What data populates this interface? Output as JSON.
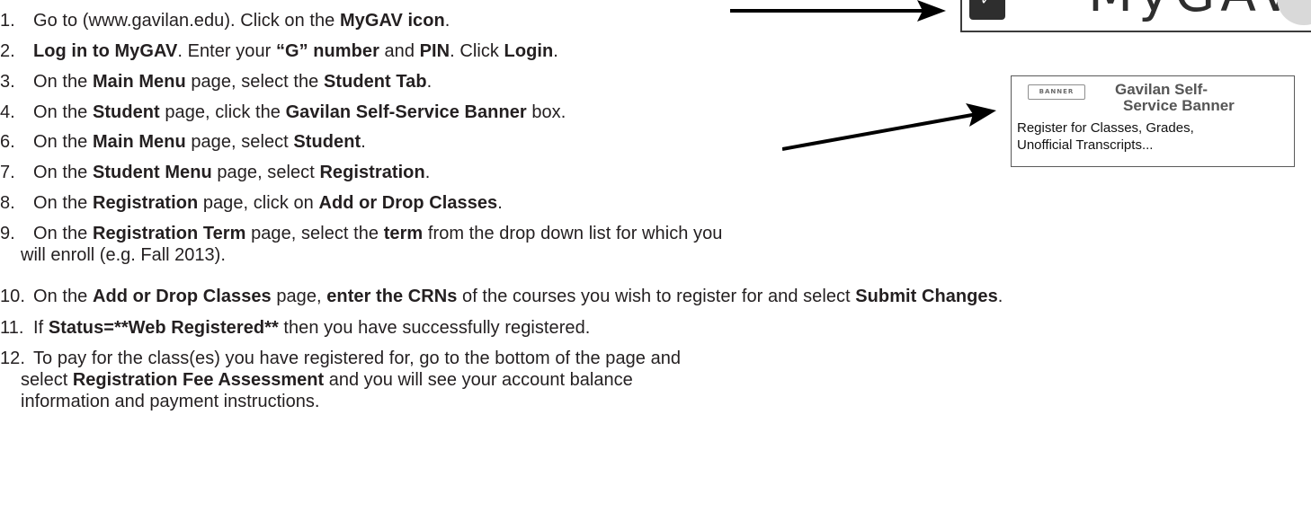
{
  "steps": [
    {
      "num": "1.",
      "parts": [
        {
          "t": "Go to (www.gavilan.edu). Click on the ",
          "b": false
        },
        {
          "t": "MyGAV icon",
          "b": true
        },
        {
          "t": ".",
          "b": false
        }
      ]
    },
    {
      "num": "2.",
      "parts": [
        {
          "t": "Log in to MyGAV",
          "b": true
        },
        {
          "t": ". Enter your ",
          "b": false
        },
        {
          "t": "“G” number",
          "b": true
        },
        {
          "t": " and ",
          "b": false
        },
        {
          "t": "PIN",
          "b": true
        },
        {
          "t": ".  Click ",
          "b": false
        },
        {
          "t": "Login",
          "b": true
        },
        {
          "t": ".",
          "b": false
        }
      ]
    },
    {
      "num": "3.",
      "parts": [
        {
          "t": "On the ",
          "b": false
        },
        {
          "t": "Main Menu",
          "b": true
        },
        {
          "t": " page, select the ",
          "b": false
        },
        {
          "t": "Student Tab",
          "b": true
        },
        {
          "t": ".",
          "b": false
        }
      ]
    },
    {
      "num": "4.",
      "parts": [
        {
          "t": "On the ",
          "b": false
        },
        {
          "t": "Student",
          "b": true
        },
        {
          "t": " page, click the ",
          "b": false
        },
        {
          "t": "Gavilan Self-Service Banner",
          "b": true
        },
        {
          "t": " box.",
          "b": false
        }
      ]
    },
    {
      "num": "6.",
      "parts": [
        {
          "t": "On the ",
          "b": false
        },
        {
          "t": "Main Menu",
          "b": true
        },
        {
          "t": " page, select ",
          "b": false
        },
        {
          "t": "Student",
          "b": true
        },
        {
          "t": ".",
          "b": false
        }
      ]
    },
    {
      "num": "7.",
      "parts": [
        {
          "t": "On the ",
          "b": false
        },
        {
          "t": "Student Menu",
          "b": true
        },
        {
          "t": " page, select ",
          "b": false
        },
        {
          "t": "Registration",
          "b": true
        },
        {
          "t": ".",
          "b": false
        }
      ]
    },
    {
      "num": "8.",
      "parts": [
        {
          "t": "On the ",
          "b": false
        },
        {
          "t": "Registration",
          "b": true
        },
        {
          "t": " page, click on ",
          "b": false
        },
        {
          "t": "Add or Drop Classes",
          "b": true
        },
        {
          "t": ".",
          "b": false
        }
      ]
    },
    {
      "num": "9.",
      "parts": [
        {
          "t": "On the ",
          "b": false
        },
        {
          "t": "Registration Term",
          "b": true
        },
        {
          "t": " page, select the ",
          "b": false
        },
        {
          "t": "term",
          "b": true
        },
        {
          "t": " from the drop down list for which you",
          "b": false
        }
      ],
      "cont": [
        "will enroll (e.g. Fall 2013)."
      ]
    },
    {
      "num": "10.",
      "parts": [
        {
          "t": "On the ",
          "b": false
        },
        {
          "t": "Add or Drop Classes",
          "b": true
        },
        {
          "t": " page, ",
          "b": false
        },
        {
          "t": "enter the CRNs",
          "b": true
        },
        {
          "t": " of the courses you wish to register for and select ",
          "b": false
        },
        {
          "t": "Submit Changes",
          "b": true
        },
        {
          "t": ".",
          "b": false
        }
      ]
    },
    {
      "num": "11.",
      "parts": [
        {
          "t": "If ",
          "b": false
        },
        {
          "t": "Status=**Web Registered**",
          "b": true
        },
        {
          "t": " then you have successfully registered.",
          "b": false
        }
      ]
    },
    {
      "num": "12.",
      "parts": [
        {
          "t": "To pay for the class(es) you have registered for, go to the bottom of the page and",
          "b": false
        }
      ],
      "cont": [
        [
          {
            "t": "select ",
            "b": false
          },
          {
            "t": "Registration Fee Assessment",
            "b": true
          },
          {
            "t": " and you will see your account balance",
            "b": false
          }
        ],
        "information and payment instructions."
      ]
    }
  ],
  "logo": {
    "text": "MyGAV",
    "icon": "mygav-logo-icon"
  },
  "banner_box": {
    "tag": "BANNER",
    "title_line1": "Gavilan Self-",
    "title_line2": "Service Banner",
    "desc_line1": "Register for Classes, Grades,",
    "desc_line2": "Unofficial Transcripts..."
  },
  "colors": {
    "text": "#231f20",
    "box_title": "#555555"
  }
}
